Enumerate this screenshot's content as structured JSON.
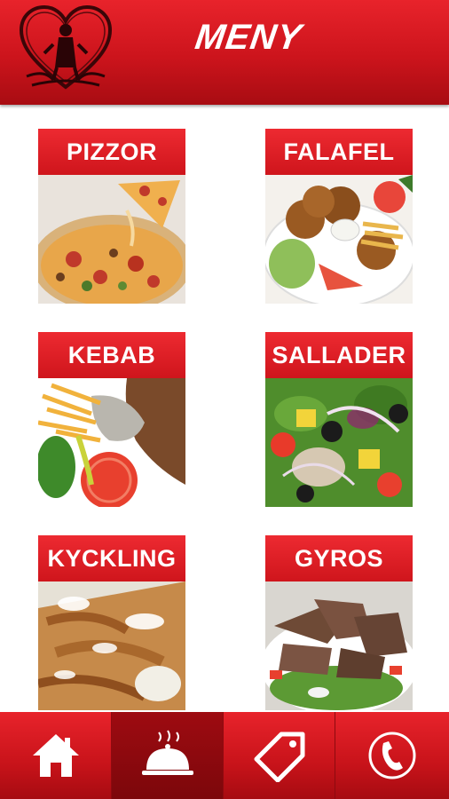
{
  "header": {
    "title": "MENY",
    "logo_icon": "heart-logo-icon"
  },
  "menu": {
    "items": [
      {
        "label": "PIZZOR",
        "image": "pizza-image"
      },
      {
        "label": "FALAFEL",
        "image": "falafel-image"
      },
      {
        "label": "KEBAB",
        "image": "kebab-image"
      },
      {
        "label": "SALLADER",
        "image": "salad-image"
      },
      {
        "label": "KYCKLING",
        "image": "chicken-image"
      },
      {
        "label": "GYROS",
        "image": "gyros-image"
      }
    ]
  },
  "bottom_nav": {
    "items": [
      {
        "icon": "home-icon",
        "active": false
      },
      {
        "icon": "food-cloche-icon",
        "active": true
      },
      {
        "icon": "price-tag-icon",
        "active": false
      },
      {
        "icon": "phone-icon",
        "active": false
      }
    ]
  },
  "colors": {
    "brand_red": "#e01e26",
    "active_nav": "#8a090e",
    "background": "#ffffff"
  }
}
